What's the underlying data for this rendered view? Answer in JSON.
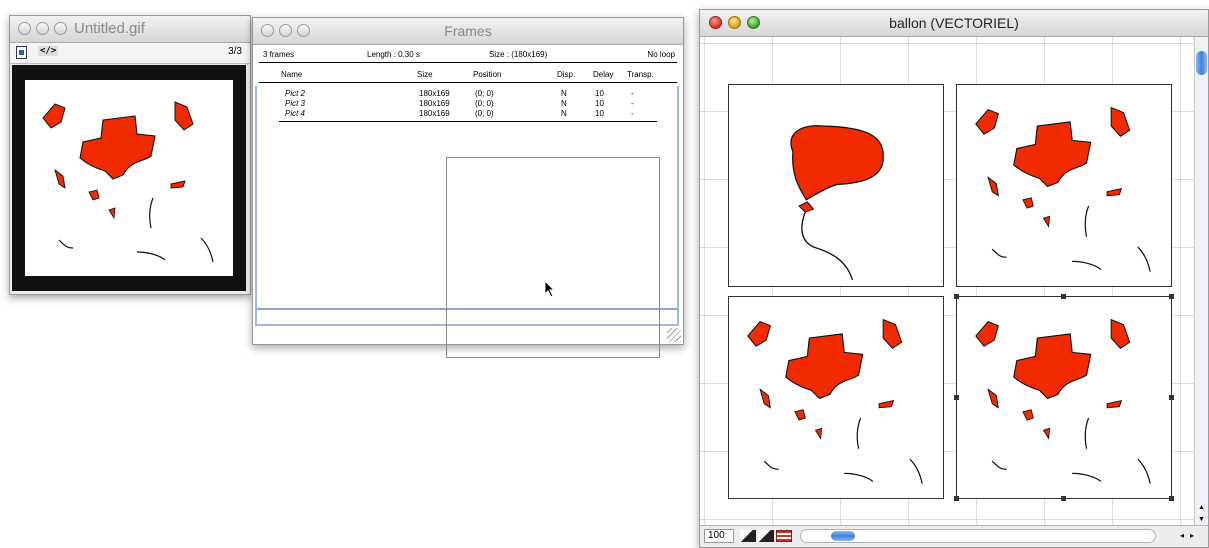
{
  "untitled_window": {
    "title": "Untitled.gif",
    "frame_counter": "3/3"
  },
  "frames_window": {
    "title": "Frames",
    "summary": {
      "count": "3 frames",
      "length": "Length : 0.30 s",
      "size": "Size : (180x169)",
      "loop": "No loop"
    },
    "columns": [
      "Name",
      "Size",
      "Position",
      "Disp.",
      "Delay",
      "Transp."
    ],
    "rows": [
      {
        "name": "Pict 2",
        "size": "180x169",
        "position": "(0; 0)",
        "disp": "N",
        "delay": "10",
        "transp": "-"
      },
      {
        "name": "Pict 3",
        "size": "180x169",
        "position": "(0; 0)",
        "disp": "N",
        "delay": "10",
        "transp": "-"
      },
      {
        "name": "Pict 4",
        "size": "180x169",
        "position": "(0; 0)",
        "disp": "N",
        "delay": "10",
        "transp": "-"
      }
    ]
  },
  "vector_window": {
    "title": "ballon (VECTORIEL)",
    "zoom": "100"
  },
  "colors": {
    "balloon_red": "#f22a00",
    "accent_blue": "#3b82dc"
  }
}
